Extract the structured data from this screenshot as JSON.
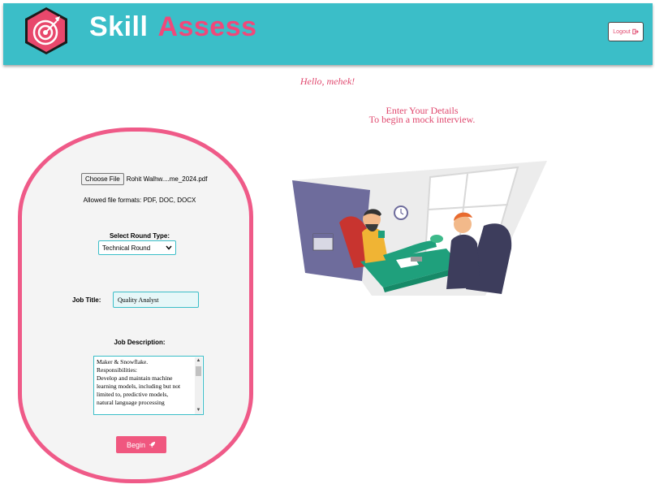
{
  "header": {
    "brand_part1": "Skill",
    "brand_part2": "Assess",
    "logout_label": "Logout",
    "logo_icon": "target-dart-icon",
    "colors": {
      "header_bg": "#3bbec8",
      "accent": "#f0487a",
      "logo_hex": "#e8486c"
    }
  },
  "greeting": "Hello, mehek!",
  "intro": {
    "line1": "Enter Your Details",
    "line2": "To begin a mock interview."
  },
  "form": {
    "choose_file_label": "Choose File",
    "file_name": "Rohit Walhw....me_2024.pdf",
    "allowed_formats": "Allowed file formats: PDF, DOC, DOCX",
    "round_label": "Select Round Type:",
    "round_value": "Technical Round",
    "job_title_label": "Job Title:",
    "job_title_value": "Quality Analyst",
    "job_desc_label": "Job Description:",
    "job_desc_lines": [
      "Maker & Snowflake.",
      "Responsibilities:",
      "Develop and maintain machine",
      "learning models, including but not",
      "limited to, predictive models,",
      "natural language processing"
    ],
    "begin_label": "Begin"
  }
}
